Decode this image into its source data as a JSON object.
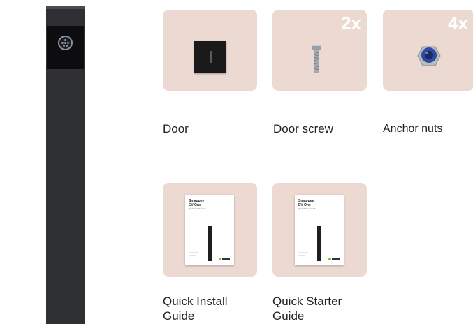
{
  "charger": {
    "socket_icon": "charging-socket-icon"
  },
  "items": [
    {
      "label": "Door",
      "quantity": "",
      "icon": "door-icon"
    },
    {
      "label": "Door screw",
      "quantity": "2x",
      "icon": "screw-icon"
    },
    {
      "label": "Anchor nuts",
      "quantity": "4x",
      "icon": "nut-icon"
    },
    {
      "label": "Quick Install Guide",
      "quantity": "",
      "icon": "booklet-icon"
    },
    {
      "label": "Quick Starter Guide",
      "quantity": "",
      "icon": "booklet-icon"
    }
  ],
  "booklet": {
    "brand": "Smappee",
    "product": "EV One",
    "install_title": "Quick Install Guide",
    "starter_title": "QuickStarter Guide"
  },
  "colors": {
    "card_bg": "#ecd9d2",
    "pillar": "#2e3033",
    "accent_green": "#7fbf3f"
  }
}
